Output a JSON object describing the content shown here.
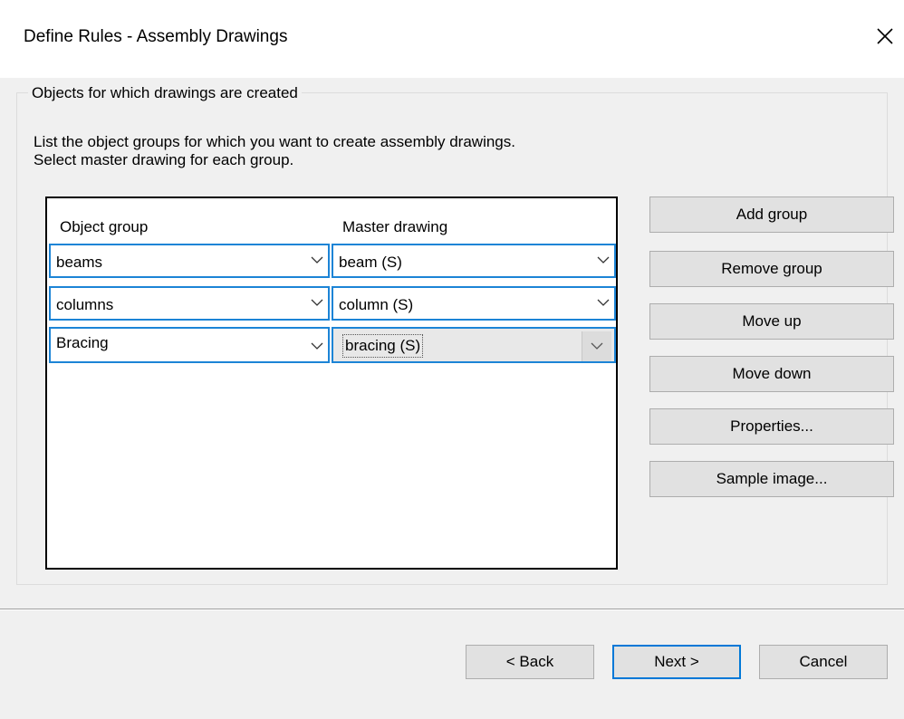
{
  "window": {
    "title": "Define Rules - Assembly Drawings",
    "close_icon": "close-icon"
  },
  "groupbox": {
    "legend": "Objects for which drawings are created",
    "instructions_line1": "List the object groups for which you want to create assembly drawings.",
    "instructions_line2": "Select master drawing for each group."
  },
  "table": {
    "columns": [
      "Object group",
      "Master drawing"
    ],
    "rows": [
      {
        "object_group": "beams",
        "master_drawing": "beam (S)"
      },
      {
        "object_group": "columns",
        "master_drawing": "column (S)"
      },
      {
        "object_group": "Bracing",
        "master_drawing": "bracing (S)"
      }
    ]
  },
  "side_buttons": {
    "add_group": "Add group",
    "remove_group": "Remove group",
    "move_up": "Move up",
    "move_down": "Move down",
    "properties": "Properties...",
    "sample_image": "Sample image..."
  },
  "footer": {
    "back": "< Back",
    "next": "Next >",
    "cancel": "Cancel"
  },
  "colors": {
    "focus_border": "#1c84d6",
    "default_button_border": "#0078d7",
    "dialog_background": "#f0f0f0"
  }
}
